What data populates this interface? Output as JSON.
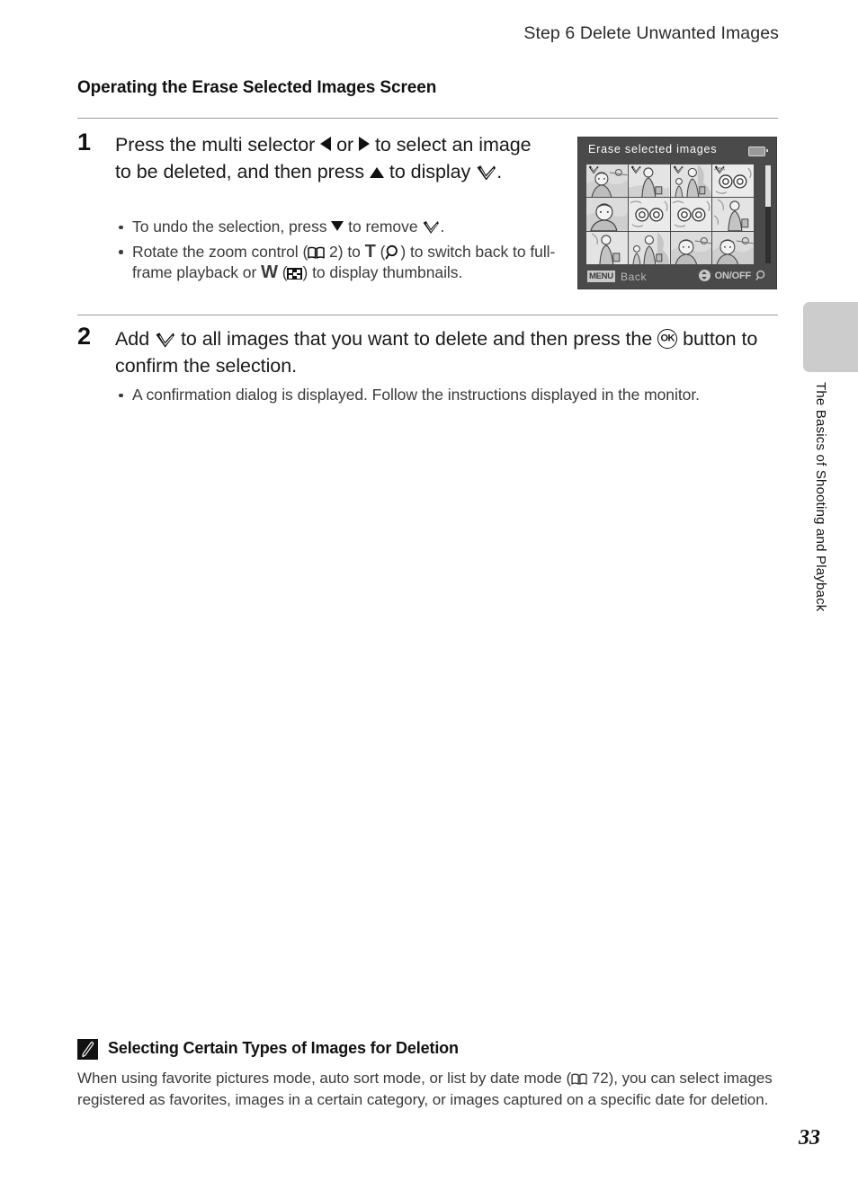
{
  "header": {
    "running_title": "Step 6 Delete Unwanted Images"
  },
  "section": {
    "heading": "Operating the Erase Selected Images Screen"
  },
  "steps": [
    {
      "number": "1",
      "text_part1": "Press the multi selector ",
      "icon_left": "left-triangle-icon",
      "text_part2": " or ",
      "icon_right": "right-triangle-icon",
      "text_part3": " to select an image to be deleted, and then press ",
      "icon_up": "up-triangle-icon",
      "text_part4": " to display ",
      "icon_check": "selection-check-icon",
      "text_part5": ".",
      "bullets": [
        {
          "t1": "To undo the selection, press ",
          "icon1": "down-triangle-icon",
          "t2": " to remove ",
          "icon2": "selection-check-icon",
          "t3": "."
        },
        {
          "t1": "Rotate the zoom control (",
          "icon1": "book-reference-icon",
          "t2": " 2) to ",
          "letter1": "T",
          "t3": " (",
          "icon2": "magnifier-icon",
          "t4": ") to switch back to full-frame playback or ",
          "letter2": "W",
          "t5": " (",
          "icon3": "thumbnail-grid-icon",
          "t6": ") to display thumbnails."
        }
      ]
    },
    {
      "number": "2",
      "text_part1": "Add ",
      "icon_check": "selection-check-icon",
      "text_part2": " to all images that you want to delete and then press the ",
      "icon_ok": "ok-button-icon",
      "ok_label": "OK",
      "text_part3": " button to confirm the selection.",
      "bullets": [
        {
          "t1": "A confirmation dialog is displayed. Follow the instructions displayed in the monitor."
        }
      ]
    }
  ],
  "camera_screen": {
    "title": "Erase selected images",
    "battery_icon": "battery-icon",
    "back_chip": "MENU",
    "back_label": "Back",
    "onoff_icon": "multi-selector-icon",
    "onoff_label": "ON/OFF",
    "zoom_icon": "magnifier-icon",
    "selected_count": 4,
    "thumbnails": [
      {
        "id": 1,
        "checked": true,
        "highlighted": true,
        "scene": "portrait-sunset"
      },
      {
        "id": 2,
        "checked": true,
        "highlighted": false,
        "scene": "woman-standing"
      },
      {
        "id": 3,
        "checked": true,
        "highlighted": false,
        "scene": "mother-and-child"
      },
      {
        "id": 4,
        "checked": true,
        "highlighted": false,
        "scene": "flowers"
      },
      {
        "id": 5,
        "checked": false,
        "highlighted": false,
        "scene": "portrait-closeup"
      },
      {
        "id": 6,
        "checked": false,
        "highlighted": false,
        "scene": "flowers"
      },
      {
        "id": 7,
        "checked": false,
        "highlighted": false,
        "scene": "flowers"
      },
      {
        "id": 8,
        "checked": false,
        "highlighted": false,
        "scene": "woman-with-bag"
      },
      {
        "id": 9,
        "checked": false,
        "highlighted": false,
        "scene": "woman-with-bag"
      },
      {
        "id": 10,
        "checked": false,
        "highlighted": false,
        "scene": "mother-and-child"
      },
      {
        "id": 11,
        "checked": false,
        "highlighted": false,
        "scene": "portrait-sunset"
      },
      {
        "id": 12,
        "checked": false,
        "highlighted": false,
        "scene": "portrait-sunset"
      }
    ]
  },
  "chapter_tab": {
    "label": "The Basics of Shooting and Playback",
    "color": "#cccccc"
  },
  "note": {
    "icon": "pencil-note-icon",
    "title": "Selecting Certain Types of Images for Deletion",
    "body_part1": "When using favorite pictures mode, auto sort mode, or list by date mode (",
    "icon_ref": "book-reference-icon",
    "body_part2": " 72), you can select images registered as favorites, images in a certain category, or images captured on a specific date for deletion."
  },
  "page_number": "33"
}
